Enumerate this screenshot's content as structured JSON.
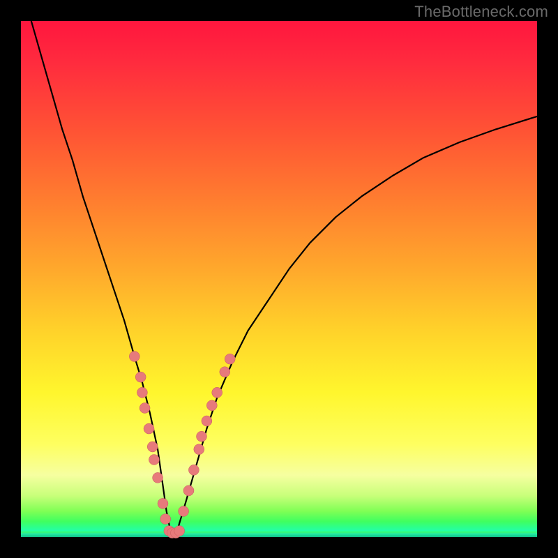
{
  "watermark": "TheBottleneck.com",
  "colors": {
    "dot_fill": "#e77a7b",
    "dot_stroke": "#c55a5b",
    "curve": "#000000",
    "frame": "#000000"
  },
  "chart_data": {
    "type": "line",
    "title": "",
    "xlabel": "",
    "ylabel": "",
    "xlim": [
      0,
      100
    ],
    "ylim": [
      0,
      100
    ],
    "grid": false,
    "legend": false,
    "series": [
      {
        "name": "bottleneck-curve",
        "x": [
          2,
          4,
          6,
          8,
          10,
          12,
          14,
          16,
          18,
          20,
          22,
          23.5,
          25,
          26.5,
          27.5,
          28.2,
          28.8,
          29.5,
          30.5,
          32,
          34,
          36,
          38,
          41,
          44,
          48,
          52,
          56,
          61,
          66,
          72,
          78,
          85,
          92,
          100
        ],
        "y": [
          100,
          93,
          86,
          79,
          73,
          66,
          60,
          54,
          48,
          42,
          35,
          30,
          24,
          17,
          10,
          5,
          2,
          0.7,
          2,
          7,
          14,
          21,
          27,
          34,
          40,
          46,
          52,
          57,
          62,
          66,
          70,
          73.5,
          76.5,
          79,
          81.5
        ]
      }
    ],
    "scatter": [
      {
        "name": "left-branch-dots",
        "points": [
          {
            "x": 22.0,
            "y": 35.0
          },
          {
            "x": 23.2,
            "y": 31.0
          },
          {
            "x": 23.5,
            "y": 28.0
          },
          {
            "x": 24.0,
            "y": 25.0
          },
          {
            "x": 24.8,
            "y": 21.0
          },
          {
            "x": 25.5,
            "y": 17.5
          },
          {
            "x": 25.8,
            "y": 15.0
          },
          {
            "x": 26.5,
            "y": 11.5
          },
          {
            "x": 27.5,
            "y": 6.5
          },
          {
            "x": 28.0,
            "y": 3.5
          }
        ]
      },
      {
        "name": "right-branch-dots",
        "points": [
          {
            "x": 31.5,
            "y": 5.0
          },
          {
            "x": 32.5,
            "y": 9.0
          },
          {
            "x": 33.5,
            "y": 13.0
          },
          {
            "x": 34.5,
            "y": 17.0
          },
          {
            "x": 35.0,
            "y": 19.5
          },
          {
            "x": 36.0,
            "y": 22.5
          },
          {
            "x": 37.0,
            "y": 25.5
          },
          {
            "x": 38.0,
            "y": 28.0
          },
          {
            "x": 39.5,
            "y": 32.0
          },
          {
            "x": 40.5,
            "y": 34.5
          }
        ]
      },
      {
        "name": "valley-floor-dots",
        "points": [
          {
            "x": 28.7,
            "y": 1.2
          },
          {
            "x": 29.3,
            "y": 0.8
          },
          {
            "x": 30.0,
            "y": 0.8
          },
          {
            "x": 30.7,
            "y": 1.2
          }
        ]
      }
    ]
  }
}
